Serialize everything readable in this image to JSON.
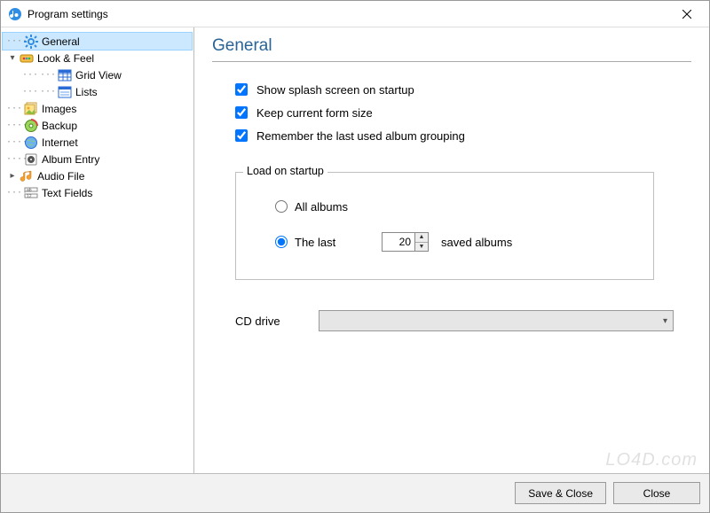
{
  "window": {
    "title": "Program settings"
  },
  "sidebar": {
    "items": [
      {
        "label": "General",
        "icon": "gear-icon",
        "selected": true,
        "depth": 0,
        "twist": "dots"
      },
      {
        "label": "Look & Feel",
        "icon": "palette-icon",
        "selected": false,
        "depth": 0,
        "twist": "open"
      },
      {
        "label": "Grid View",
        "icon": "table-icon",
        "selected": false,
        "depth": 1,
        "twist": "dots"
      },
      {
        "label": "Lists",
        "icon": "list-icon",
        "selected": false,
        "depth": 1,
        "twist": "dots"
      },
      {
        "label": "Images",
        "icon": "images-icon",
        "selected": false,
        "depth": 0,
        "twist": "dots"
      },
      {
        "label": "Backup",
        "icon": "disk-icon",
        "selected": false,
        "depth": 0,
        "twist": "dots"
      },
      {
        "label": "Internet",
        "icon": "globe-icon",
        "selected": false,
        "depth": 0,
        "twist": "dots"
      },
      {
        "label": "Album Entry",
        "icon": "album-icon",
        "selected": false,
        "depth": 0,
        "twist": "dots"
      },
      {
        "label": "Audio File",
        "icon": "audio-icon",
        "selected": false,
        "depth": 0,
        "twist": "closed"
      },
      {
        "label": "Text Fields",
        "icon": "fields-icon",
        "selected": false,
        "depth": 0,
        "twist": "dots"
      }
    ]
  },
  "panel": {
    "title": "General",
    "checkboxes": {
      "splash": {
        "label": "Show splash screen on startup",
        "checked": true
      },
      "formsize": {
        "label": "Keep current form size",
        "checked": true
      },
      "grouping": {
        "label": "Remember the last used album grouping",
        "checked": true
      }
    },
    "load_startup": {
      "group_title": "Load on startup",
      "all_label": "All albums",
      "last_label": "The last",
      "count": "20",
      "suffix": "saved albums",
      "selected": "last"
    },
    "cd_drive": {
      "label": "CD drive",
      "value": ""
    }
  },
  "buttons": {
    "save": "Save & Close",
    "close": "Close"
  },
  "watermark": "LO4D.com"
}
